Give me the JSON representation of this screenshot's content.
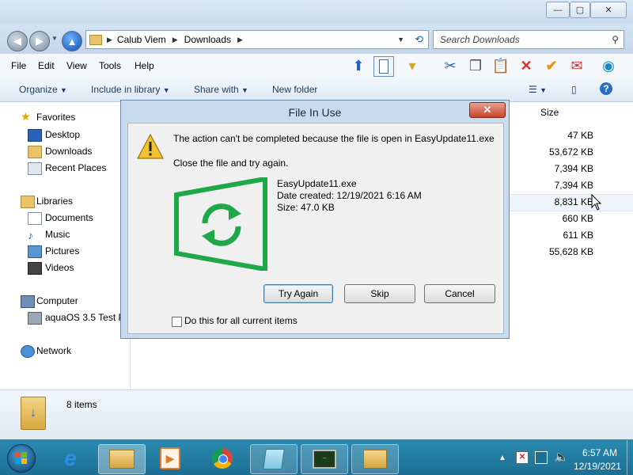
{
  "window": {
    "caption_buttons": {
      "minimize": "—",
      "maximize": "▢",
      "close": "✕"
    }
  },
  "address": {
    "segments": [
      "Calub Viem",
      "Downloads"
    ],
    "search_placeholder": "Search Downloads"
  },
  "menu": [
    "File",
    "Edit",
    "View",
    "Tools",
    "Help"
  ],
  "commands": {
    "organize": "Organize",
    "include_in_library": "Include in library",
    "share_with": "Share with",
    "new_folder": "New folder"
  },
  "navigation": {
    "favorites": "Favorites",
    "favorites_items": [
      "Desktop",
      "Downloads",
      "Recent Places"
    ],
    "libraries": "Libraries",
    "libraries_items": [
      "Documents",
      "Music",
      "Pictures",
      "Videos"
    ],
    "computer": "Computer",
    "computer_items": [
      "aquaOS 3.5 Test P"
    ],
    "network": "Network"
  },
  "file_list": {
    "size_header": "Size",
    "sizes": [
      "47 KB",
      "53,672 KB",
      "7,394 KB",
      "7,394 KB",
      "8,831 KB",
      "660 KB",
      "611 KB",
      "55,628 KB"
    ]
  },
  "details_pane": {
    "item_count": "8 items"
  },
  "dialog": {
    "title": "File In Use",
    "close": "✕",
    "message": "The action can't be completed because the file is open in EasyUpdate11.exe",
    "instruction": "Close the file and try again.",
    "file_name": "EasyUpdate11.exe",
    "date_created": "Date created: 12/19/2021 6:16 AM",
    "size": "Size: 47.0 KB",
    "try_again": "Try Again",
    "skip": "Skip",
    "cancel": "Cancel",
    "do_this_for_all": "Do this for all current items"
  },
  "taskbar": {
    "clock_time": "6:57 AM",
    "clock_date": "12/19/2021"
  },
  "colors": {
    "accent": "#1fa84a",
    "taskbar": "#1d6e93",
    "dialog_frame": "#c9dbee"
  }
}
